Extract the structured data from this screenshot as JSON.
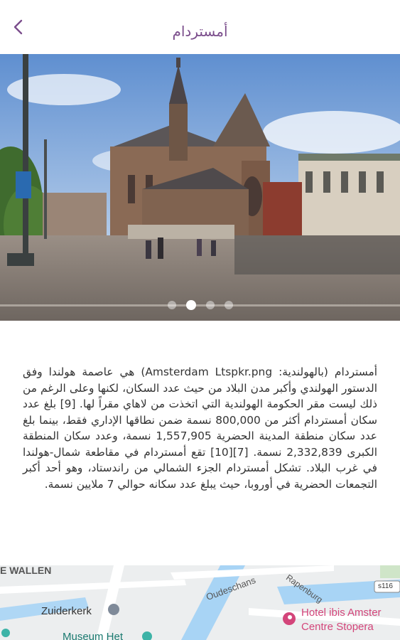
{
  "header": {
    "title": "أمستردام",
    "back_icon": "chevron-left-icon",
    "accent_color": "#7b4e8c"
  },
  "gallery": {
    "slide_count": 4,
    "active_index": 1
  },
  "description": {
    "text": "أمستردام (بالهولندية: Amsterdam Ltspkr.png) هي عاصمة هولندا وفق الدستور الهولندي وأكبر مدن البلاد من حيث عدد السكان، لكنها وعلى الرغم من ذلك ليست مقر الحكومة الهولندية التي اتخذت من لاهاي مقراً لها. [9] بلغ عدد سكان أمستردام أكثر من 800,000 نسمة ضمن نطاقها الإداري فقط، بينما بلغ عدد سكان منطقة المدينة الحضرية 1,557,905 نسمة، وعدد سكان المنطقة الكبرى 2,332,839 نسمة. [7][10] تقع أمستردام في مقاطعة شمال-هولندا في غرب البلاد. تشكل أمستردام الجزء الشمالي من راندستاد، وهو أحد أكبر التجمعات الحضرية في أوروبا، حيث يبلغ عدد سكانه حوالي 7 ملايين نسمة."
  },
  "map": {
    "labels": {
      "wallen": "E WALLEN",
      "zuiderkerk": "Zuiderkerk",
      "oudeschans": "Oudeschans",
      "rapenburg": "Rapenburg",
      "s116": "s116",
      "hotel_line1": "Hotel ibis Amster",
      "hotel_line2": "Centre Stopera",
      "museum": "Museum Het"
    },
    "hotel_color": "#d3457a",
    "water_color": "#a8d4f5"
  }
}
